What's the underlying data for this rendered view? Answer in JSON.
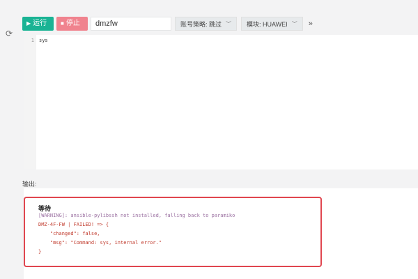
{
  "toolbar": {
    "run_label": "运行",
    "stop_label": "停止",
    "host_value": "dmzfw",
    "account_strategy_label": "账号策略: 跳过",
    "module_label": "模块: HUAWEI"
  },
  "icons": {
    "refresh": "refresh-icon",
    "run": "play-icon",
    "stop": "stop-icon",
    "chevron": "chevron-down-icon",
    "more": "double-chevron-right-icon"
  },
  "editor": {
    "line_numbers": [
      "1"
    ],
    "lines": [
      "sys"
    ]
  },
  "output": {
    "label": "输出:",
    "title": "等待",
    "lines": [
      "[WARNING]: ansible-pylibssh not installed, falling back to paramiko",
      "DMZ-4F-FW | FAILED! => {",
      "    \"changed\": false,",
      "    \"msg\": \"Command: sys, internal error.\"",
      "}"
    ]
  },
  "colors": {
    "run": "#1ab394",
    "stop": "#f0838e",
    "error_text": "#c0392b",
    "warning_text": "#9a6fa0",
    "highlight_border": "#e0464f"
  }
}
